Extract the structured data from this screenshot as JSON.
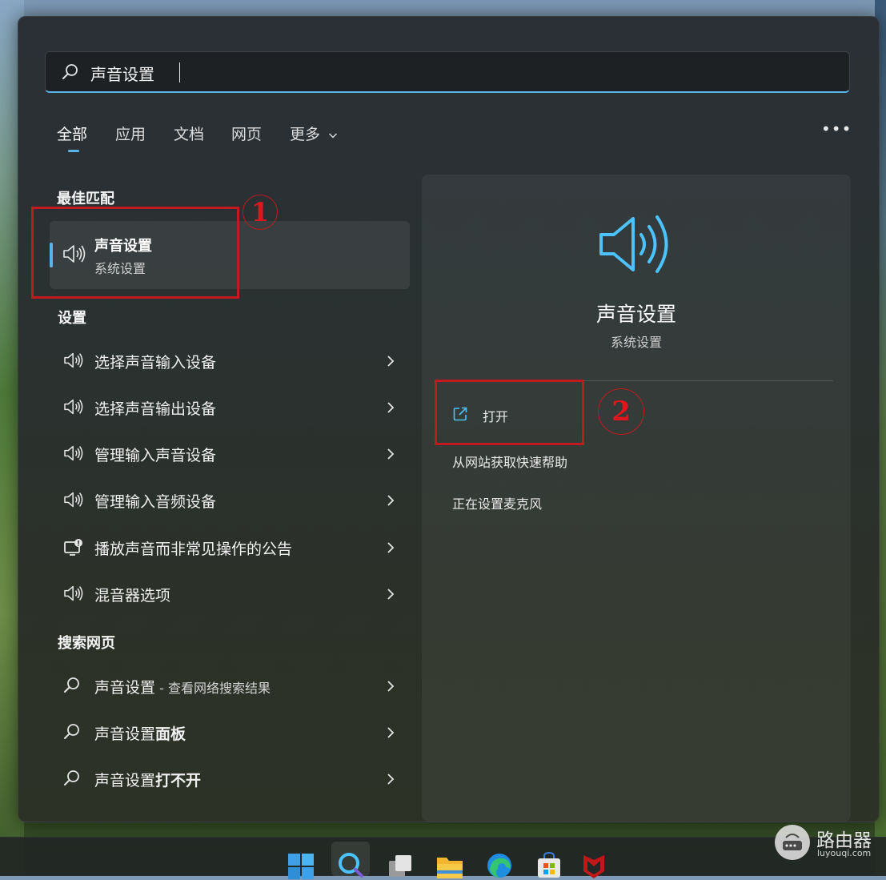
{
  "search": {
    "value": "声音设置"
  },
  "tabs": [
    {
      "label": "全部"
    },
    {
      "label": "应用"
    },
    {
      "label": "文档"
    },
    {
      "label": "网页"
    },
    {
      "label": "更多"
    }
  ],
  "more_options": "•••",
  "best_match": {
    "section_title": "最佳匹配",
    "title": "声音设置",
    "subtitle": "系统设置"
  },
  "settings": {
    "section_title": "设置",
    "items": [
      {
        "label": "选择声音输入设备",
        "icon": "speaker-icon"
      },
      {
        "label": "选择声音输出设备",
        "icon": "speaker-icon"
      },
      {
        "label": "管理输入声音设备",
        "icon": "speaker-icon"
      },
      {
        "label": "管理输入音频设备",
        "icon": "speaker-icon"
      },
      {
        "label": "播放声音而非常见操作的公告",
        "icon": "screen-notification-icon"
      },
      {
        "label": "混音器选项",
        "icon": "speaker-icon"
      }
    ]
  },
  "web_search": {
    "section_title": "搜索网页",
    "items": [
      {
        "prefix": "声音设置",
        "suffix": " - 查看网络搜索结果"
      },
      {
        "prefix": "声音设置",
        "bold": "面板"
      },
      {
        "prefix": "声音设置",
        "bold": "打不开"
      }
    ]
  },
  "detail": {
    "title": "声音设置",
    "subtitle": "系统设置",
    "actions": {
      "open": "打开",
      "help": "从网站获取快速帮助",
      "mic": "正在设置麦克风"
    }
  },
  "annotations": {
    "one": "1",
    "two": "2"
  },
  "watermark": {
    "name": "路由器",
    "url": "luyouqi.com"
  },
  "colors": {
    "accent": "#5ab4ea",
    "highlight": "#c0191f"
  }
}
